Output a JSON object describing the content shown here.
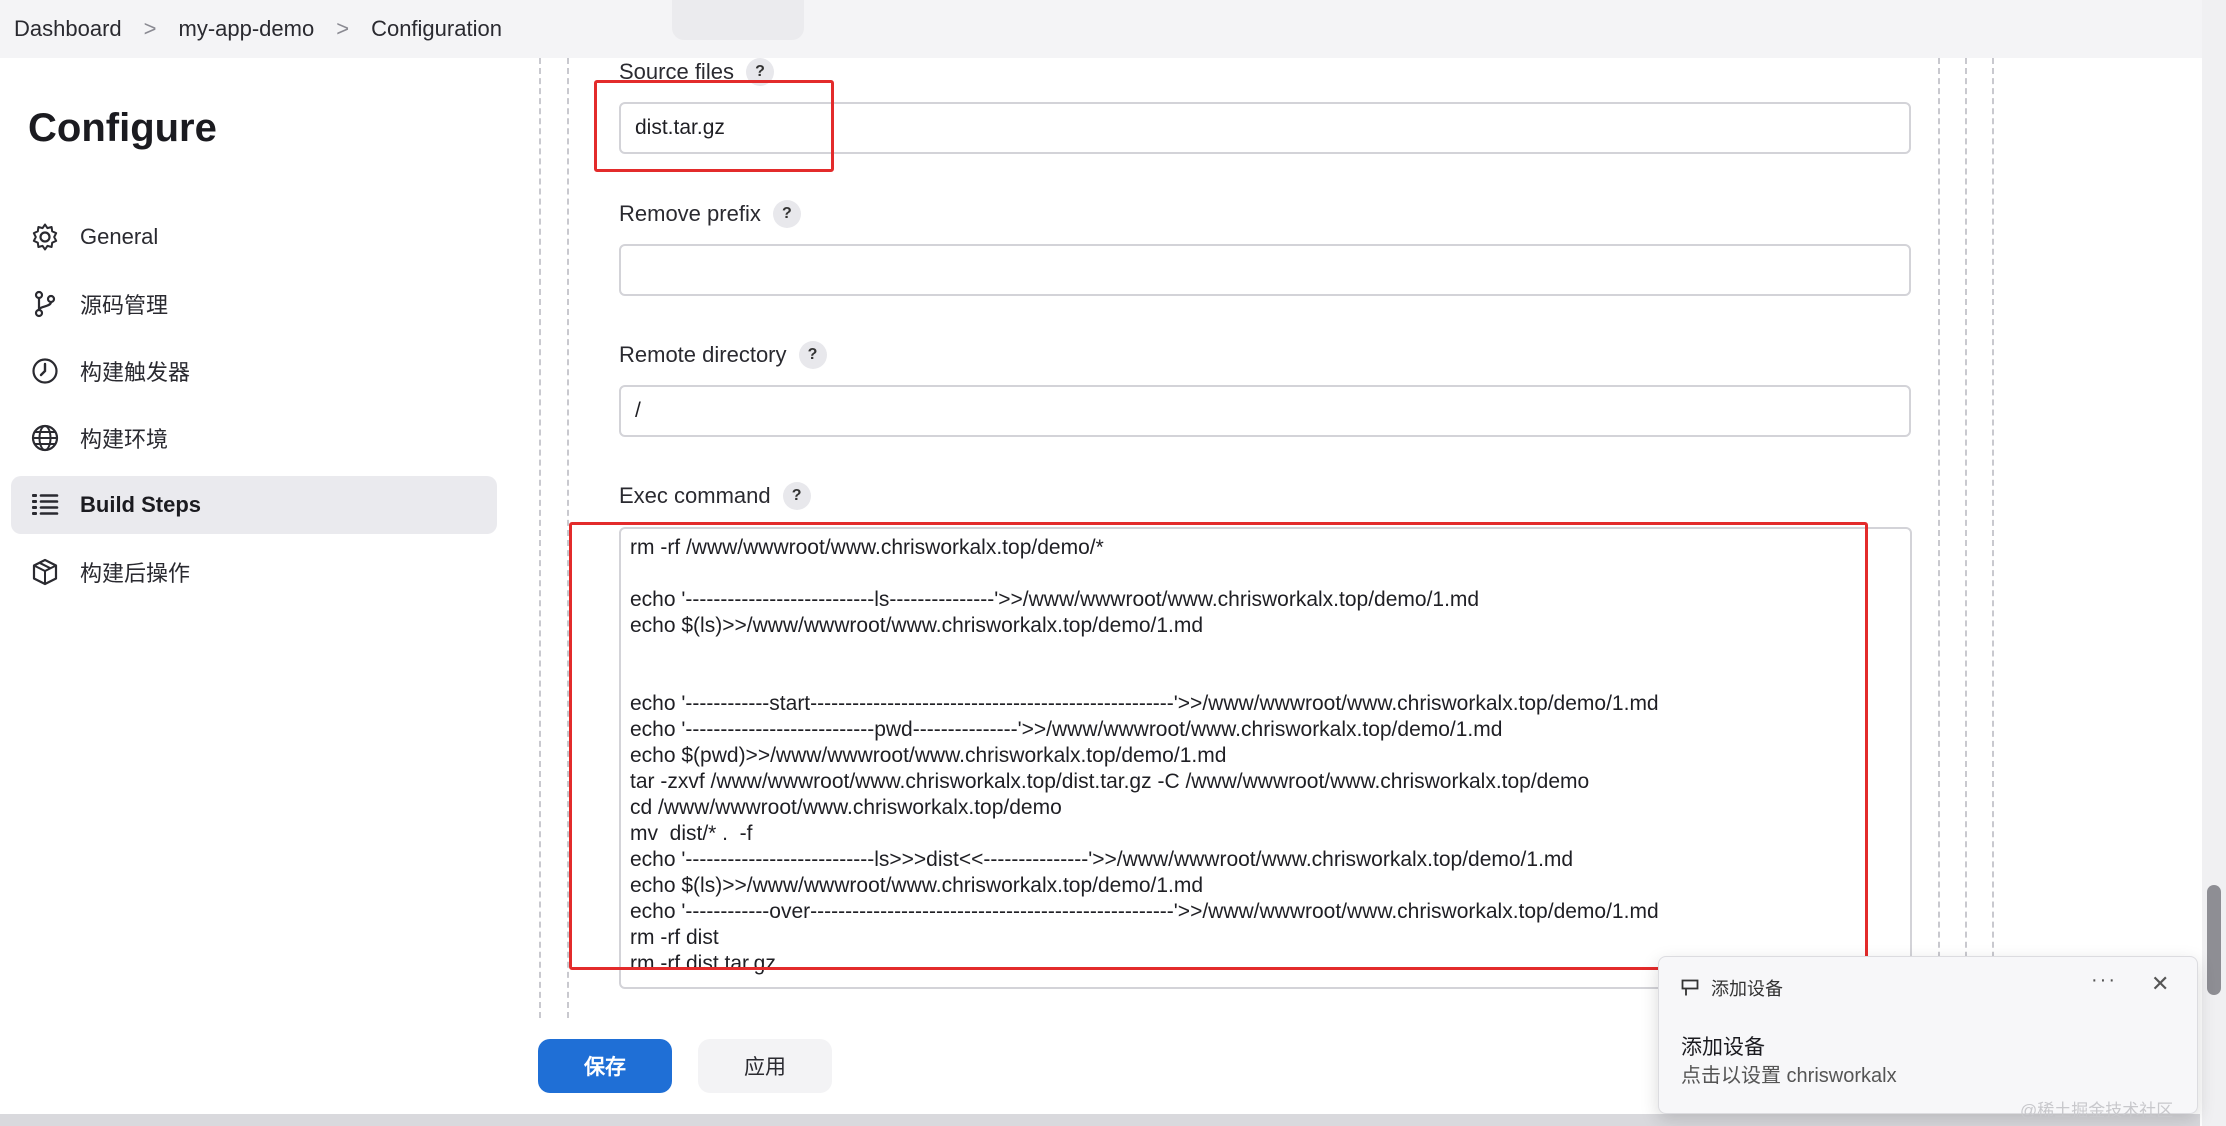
{
  "breadcrumb": {
    "items": [
      "Dashboard",
      "my-app-demo",
      "Configuration"
    ],
    "separator": ">"
  },
  "sidebar": {
    "title": "Configure",
    "items": [
      {
        "label": "General",
        "icon": "gear-icon"
      },
      {
        "label": "源码管理",
        "icon": "branch-icon"
      },
      {
        "label": "构建触发器",
        "icon": "clock-icon"
      },
      {
        "label": "构建环境",
        "icon": "globe-icon"
      },
      {
        "label": "Build Steps",
        "icon": "list-icon",
        "active": true
      },
      {
        "label": "构建后操作",
        "icon": "cube-icon"
      }
    ]
  },
  "form": {
    "source_files": {
      "label": "Source files",
      "value": "dist.tar.gz",
      "help": "?"
    },
    "remove_prefix": {
      "label": "Remove prefix",
      "value": "",
      "help": "?"
    },
    "remote_directory": {
      "label": "Remote directory",
      "value": "/",
      "help": "?"
    },
    "exec_command": {
      "label": "Exec command",
      "help": "?",
      "lines": [
        "rm -rf /www/wwwroot/www.chrisworkalx.top/demo/*",
        "",
        "echo '---------------------------ls---------------'>>/www/wwwroot/www.chrisworkalx.top/demo/1.md",
        "echo $(ls)>>/www/wwwroot/www.chrisworkalx.top/demo/1.md",
        "",
        "",
        "echo '------------start----------------------------------------------------'>>/www/wwwroot/www.chrisworkalx.top/demo/1.md",
        "echo '---------------------------pwd---------------'>>/www/wwwroot/www.chrisworkalx.top/demo/1.md",
        "echo $(pwd)>>/www/wwwroot/www.chrisworkalx.top/demo/1.md",
        "tar -zxvf /www/wwwroot/www.chrisworkalx.top/dist.tar.gz -C /www/wwwroot/www.chrisworkalx.top/demo",
        "cd /www/wwwroot/www.chrisworkalx.top/demo",
        "mv  dist/* .  -f",
        "echo '---------------------------ls>>>dist<<---------------'>>/www/wwwroot/www.chrisworkalx.top/demo/1.md",
        "echo $(ls)>>/www/wwwroot/www.chrisworkalx.top/demo/1.md",
        "echo '------------over----------------------------------------------------'>>/www/wwwroot/www.chrisworkalx.top/demo/1.md",
        "rm -rf dist",
        "rm -rf dist.tar.gz"
      ]
    }
  },
  "actions": {
    "save_label": "保存",
    "apply_label": "应用"
  },
  "toast": {
    "app_name": "添加设备",
    "more": "···",
    "close": "✕",
    "title": "添加设备",
    "body": "点击以设置 chrisworkalx"
  },
  "watermark": "@稀土掘金技术社区",
  "colors": {
    "accent": "#1f6fd6",
    "annotation": "#e32b2b",
    "active_nav_bg": "#eaeaee"
  }
}
